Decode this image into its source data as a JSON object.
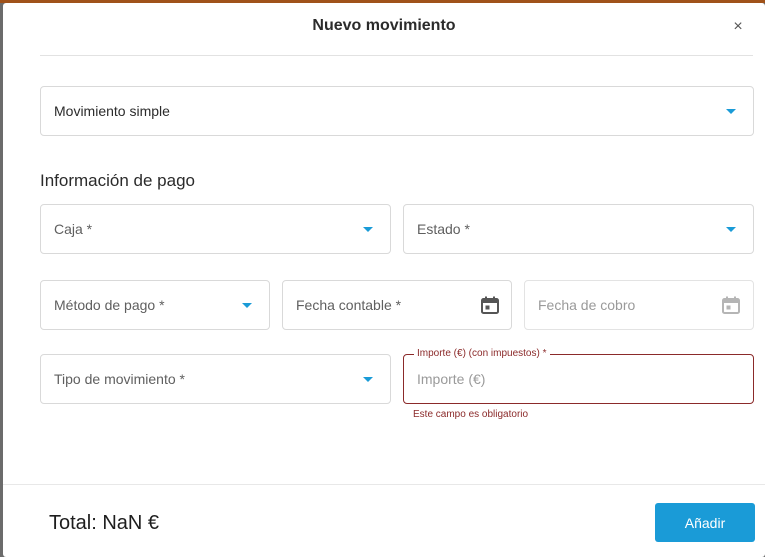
{
  "modal": {
    "title": "Nuevo movimiento",
    "close_label": "×"
  },
  "movement_type_select": {
    "value": "Movimiento simple"
  },
  "payment_section": {
    "title": "Información de pago",
    "caja": {
      "label": "Caja *"
    },
    "estado": {
      "label": "Estado *"
    },
    "metodo_pago": {
      "label": "Método de pago *"
    },
    "fecha_contable": {
      "label": "Fecha contable *"
    },
    "fecha_cobro": {
      "label": "Fecha de cobro"
    },
    "tipo_movimiento": {
      "label": "Tipo de movimiento *"
    },
    "importe": {
      "floating_label": "Importe (€) (con impuestos) *",
      "placeholder": "Importe (€)",
      "error": "Este campo es obligatorio"
    }
  },
  "footer": {
    "total": "Total: NaN €",
    "add_label": "Añadir"
  },
  "colors": {
    "accent": "#1a9bd7",
    "error": "#8b2a2a"
  },
  "icons": [
    "close-icon",
    "chevron-down-icon",
    "calendar-icon"
  ]
}
